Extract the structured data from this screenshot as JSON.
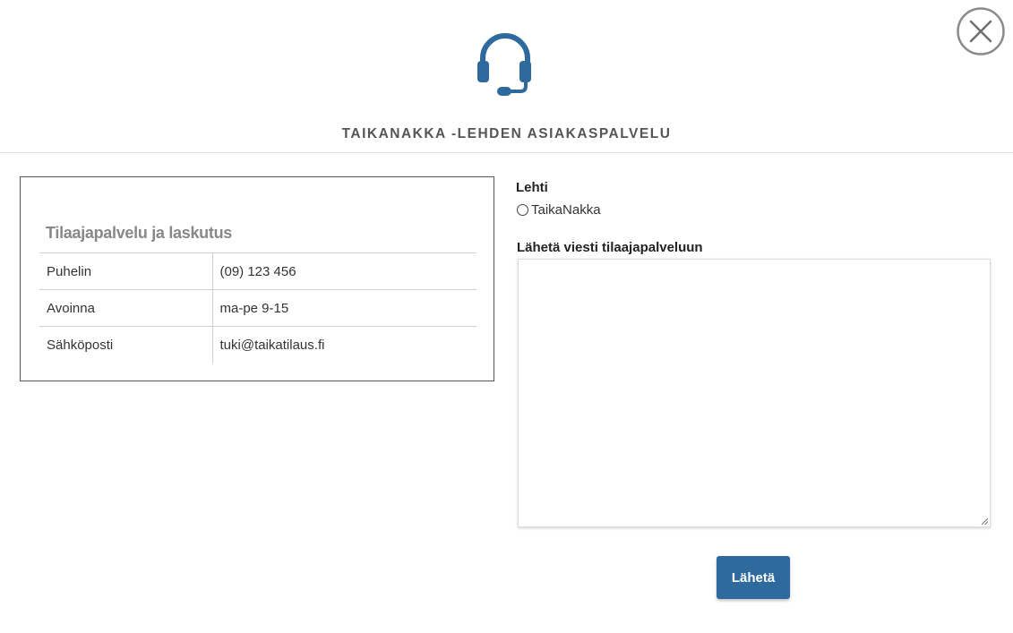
{
  "modal": {
    "title": "TAIKANAKKA -LEHDEN ASIAKASPALVELU",
    "header_icon": "headset-icon",
    "close_icon": "close-icon",
    "accent_color": "#2e6a9e"
  },
  "contact_card": {
    "title": "Tilaajapalvelu ja laskutus",
    "rows": [
      {
        "label": "Puhelin",
        "value": "(09) 123 456"
      },
      {
        "label": "Avoinna",
        "value": "ma-pe 9-15"
      },
      {
        "label": "Sähköposti",
        "value": "tuki@taikatilaus.fi"
      }
    ]
  },
  "form": {
    "magazine_label": "Lehti",
    "magazine_options": [
      {
        "label": "TaikaNakka",
        "selected": false
      }
    ],
    "message_label": "Lähetä viesti tilaajapalveluun",
    "message_value": "",
    "submit_label": "Lähetä"
  }
}
